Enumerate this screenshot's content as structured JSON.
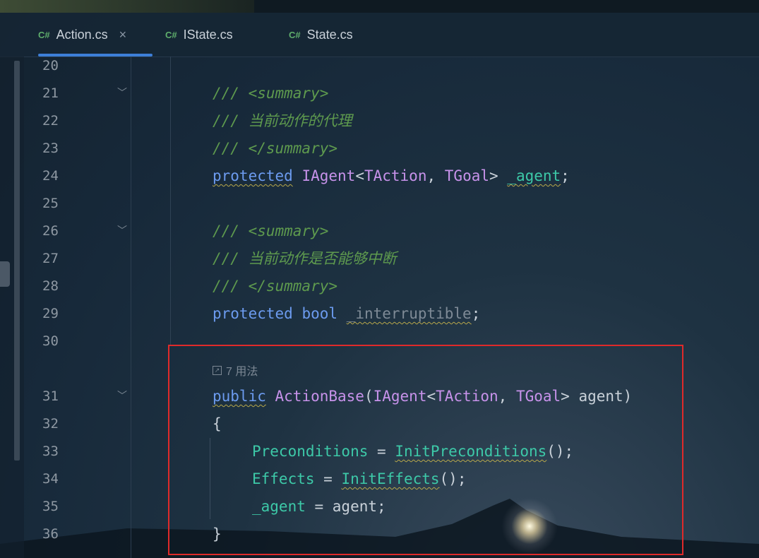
{
  "tabs": [
    {
      "lang": "C#",
      "label": "Action.cs",
      "active": true,
      "close": "×"
    },
    {
      "lang": "C#",
      "label": "IState.cs",
      "active": false
    },
    {
      "lang": "C#",
      "label": "State.cs",
      "active": false
    }
  ],
  "usage_hint": {
    "icon": "external-link-icon",
    "text": "7 用法"
  },
  "lines": {
    "l20": "20",
    "l21": "21",
    "l22": "22",
    "l23": "23",
    "l24": "24",
    "l25": "25",
    "l26": "26",
    "l27": "27",
    "l28": "28",
    "l29": "29",
    "l30": "30",
    "l31": "31",
    "l32": "32",
    "l33": "33",
    "l34": "34",
    "l35": "35",
    "l36": "36"
  },
  "code": {
    "c21": "/// <summary>",
    "c22": "/// 当前动作的代理",
    "c23": "/// </summary>",
    "c24a": "protected",
    "c24b": "IAgent",
    "c24c": "<",
    "c24d": "TAction",
    "c24e": ", ",
    "c24f": "TGoal",
    "c24g": "> ",
    "c24h": "_agent",
    "c24i": ";",
    "c26": "/// <summary>",
    "c27": "/// 当前动作是否能够中断",
    "c28": "/// </summary>",
    "c29a": "protected",
    "c29b": "bool",
    "c29c": "_interruptible",
    "c29d": ";",
    "c31a": "public",
    "c31b": "ActionBase",
    "c31c": "(",
    "c31d": "IAgent",
    "c31e": "<",
    "c31f": "TAction",
    "c31g": ", ",
    "c31h": "TGoal",
    "c31i": "> agent)",
    "c32": "{",
    "c33a": "Preconditions",
    "c33b": " = ",
    "c33c": "InitPreconditions",
    "c33d": "();",
    "c34a": "Effects",
    "c34b": " = ",
    "c34c": "InitEffects",
    "c34d": "();",
    "c35a": "_agent",
    "c35b": " = agent;",
    "c36": "}"
  },
  "colors": {
    "comment": "#5e9a4e",
    "keyword": "#6c9bef",
    "type": "#c792ea",
    "method": "#3dc9a8",
    "highlight_box": "#e02a2a"
  }
}
